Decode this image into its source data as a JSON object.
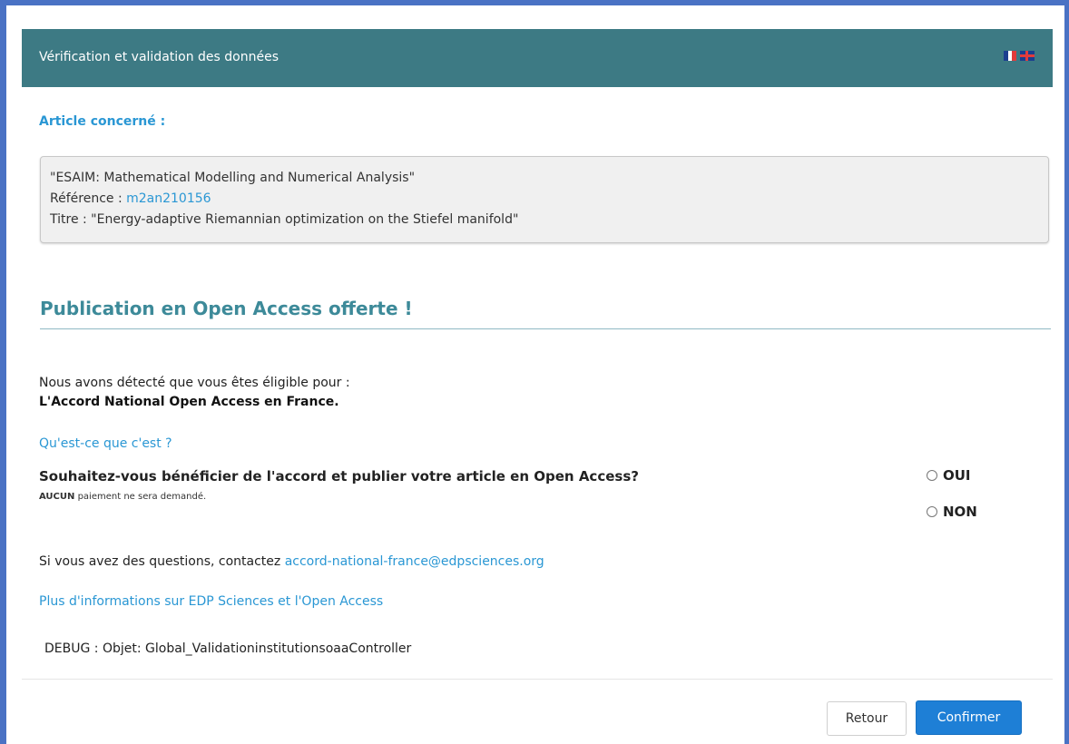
{
  "header": {
    "title": "Vérification et validation des données",
    "colors": {
      "bar": "#3d7a84",
      "frame": "#4a72c4"
    }
  },
  "article": {
    "label": "Article concerné :",
    "journal": "\"ESAIM: Mathematical Modelling and Numerical Analysis\"",
    "reference_label": "Référence :",
    "reference_value": "m2an210156",
    "title_line": "Titre : \"Energy-adaptive Riemannian optimization on the Stiefel manifold\""
  },
  "open_access": {
    "heading": "Publication en Open Access offerte !",
    "detected_line": "Nous avons détecté que vous êtes éligible pour :",
    "agreement_name": "L'Accord National Open Access en France.",
    "what_is_link": "Qu'est-ce que c'est ?",
    "question": "Souhaitez-vous bénéficier de l'accord et publier votre article en Open Access?",
    "no_payment_bold": "AUCUN",
    "no_payment_rest": "paiement ne sera demandé.",
    "options": [
      "OUI",
      "NON"
    ]
  },
  "contact": {
    "prefix": "Si vous avez des questions, contactez",
    "email": "accord-national-france@edpsciences.org",
    "more_info_link": "Plus d'informations sur EDP Sciences et l'Open Access"
  },
  "debug": {
    "text": "DEBUG : Objet: Global_ValidationinstitutionsoaaController"
  },
  "buttons": {
    "back": "Retour",
    "confirm": "Confirmer"
  },
  "icons": {
    "flag_fr": "french-flag-icon",
    "flag_uk": "uk-flag-icon"
  }
}
